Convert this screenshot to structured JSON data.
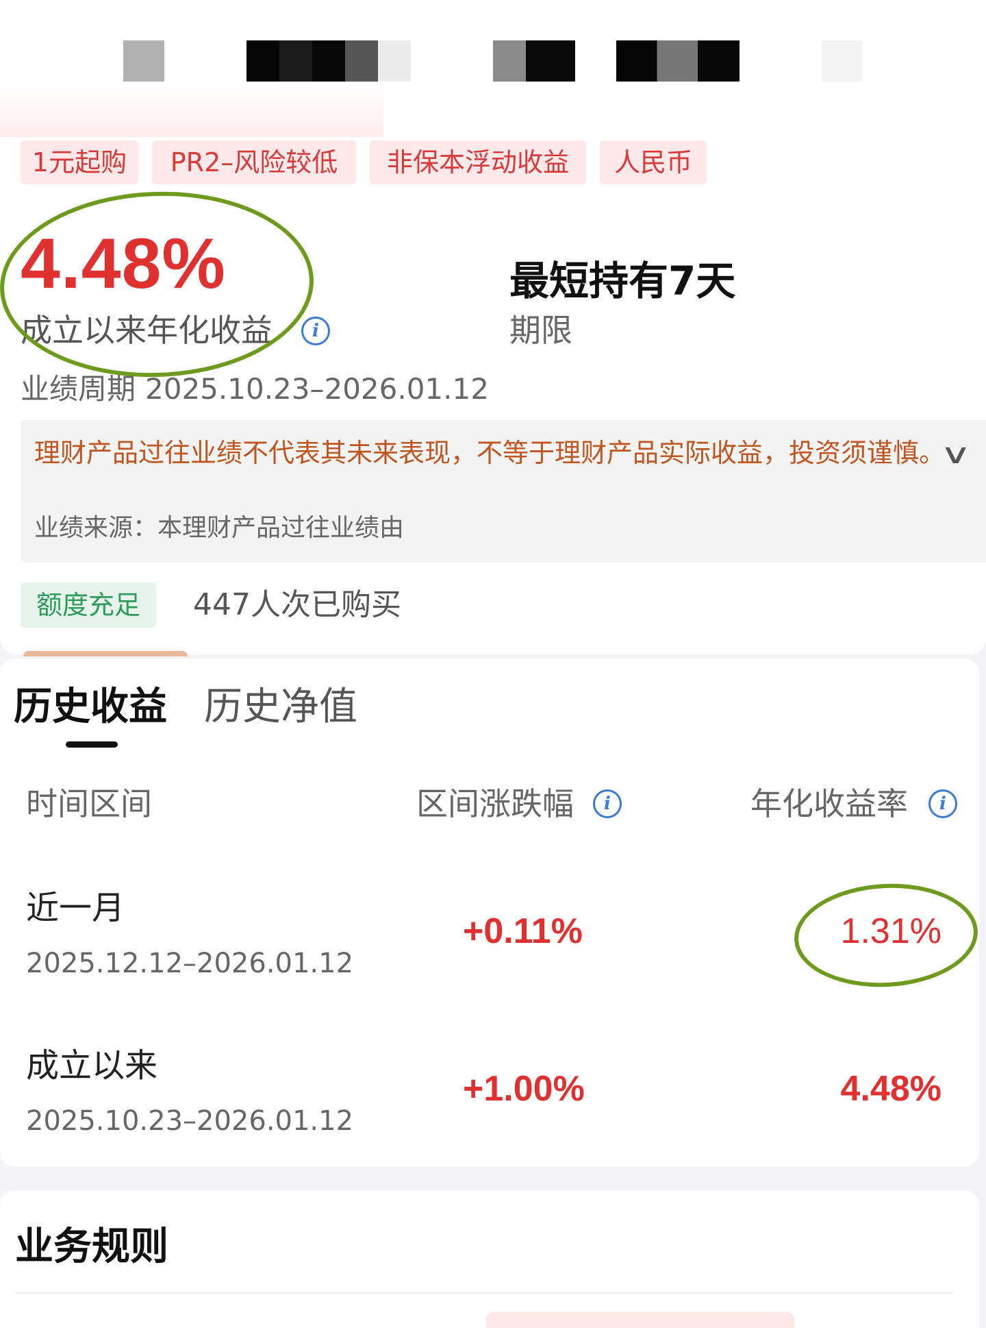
{
  "tags": [
    "1元起购",
    "PR2–风险较低",
    "非保本浮动收益",
    "人民币"
  ],
  "headline": {
    "rate": "4.48%",
    "rate_label": "成立以来年化收益",
    "min_hold": "最短持有7天",
    "min_hold_label": "期限",
    "period_label": "业绩周期",
    "period_dates": "2025.10.23–2026.01.12"
  },
  "disclaimer": {
    "main": "理财产品过往业绩不代表其未来表现，不等于理财产品实际收益，投资须谨慎。",
    "source": "业绩来源：本理财产品过往业绩由"
  },
  "status": {
    "badge": "额度充足",
    "buyers": "447人次已购买",
    "badge_color": "#2f9b5b"
  },
  "history": {
    "tabs": [
      "历史收益",
      "历史净值"
    ],
    "active_tab": "历史收益",
    "columns": [
      "时间区间",
      "区间涨跌幅",
      "年化收益率"
    ],
    "rows": [
      {
        "period": "近一月",
        "dates": "2025.12.12–2026.01.12",
        "change": "+0.11%",
        "annualized": "1.31%"
      },
      {
        "period": "成立以来",
        "dates": "2025.10.23–2026.01.12",
        "change": "+1.00%",
        "annualized": "4.48%"
      }
    ]
  },
  "rules": {
    "title": "业务规则"
  },
  "colors": {
    "accent_red": "#e03131",
    "tag_bg": "#fde9e9",
    "highlight_green": "#6e9a1e",
    "info_blue": "#3a7bd5"
  },
  "icons": {
    "info": "info-circle-icon",
    "expand": "chevron-down-icon"
  }
}
